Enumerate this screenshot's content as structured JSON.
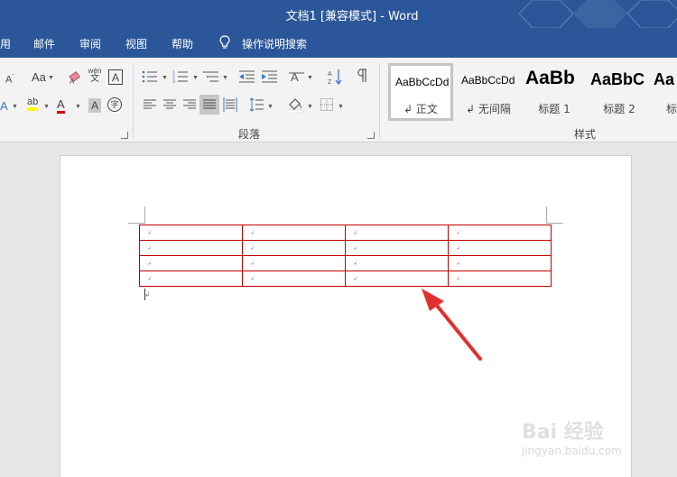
{
  "window": {
    "title": "文档1 [兼容模式]  -  Word"
  },
  "menu": {
    "items": [
      "用",
      "邮件",
      "审阅",
      "视图",
      "帮助"
    ],
    "tell_me": "操作说明搜索"
  },
  "ribbon": {
    "groups": {
      "paragraph": "段落",
      "styles": "样式"
    },
    "font_tools": {
      "change_case": "Aa",
      "phonetic_top": "wén",
      "phonetic_bottom": "文",
      "char_border": "A",
      "char_shading": "A",
      "enclose": "字",
      "font_color_letter": "A",
      "highlight_letter": "ab"
    },
    "styles": [
      {
        "sample": "AaBbCcDd",
        "name": "正文",
        "selected": true
      },
      {
        "sample": "AaBbCcDd",
        "name": "无间隔",
        "selected": false
      },
      {
        "sample": "AaBb",
        "name": "标题 1",
        "selected": false
      },
      {
        "sample": "AaBbC",
        "name": "标题 2",
        "selected": false
      },
      {
        "sample": "Aa",
        "name": "标",
        "selected": false
      }
    ]
  },
  "document": {
    "table": {
      "rows": 4,
      "cols": 4,
      "border_color": "#c00000",
      "cell_mark": "↲"
    },
    "paragraph_mark": "↲"
  },
  "annotation": {
    "arrow_color": "#e03030"
  },
  "watermark": {
    "brand": "Bai  经验",
    "url": "jingyan.baidu.com"
  }
}
